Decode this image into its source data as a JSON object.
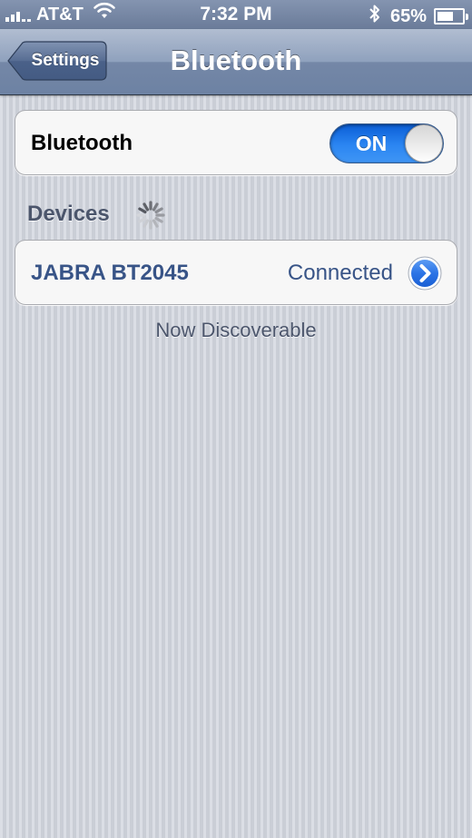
{
  "status_bar": {
    "carrier": "AT&T",
    "time": "7:32 PM",
    "battery_percent": "65%",
    "battery_level": 0.65,
    "icons": [
      "signal-icon",
      "wifi-icon",
      "bluetooth-icon",
      "battery-icon"
    ]
  },
  "nav": {
    "back_label": "Settings",
    "title": "Bluetooth"
  },
  "bluetooth_row": {
    "label": "Bluetooth",
    "toggle_label": "ON",
    "toggle_state": true
  },
  "devices_section": {
    "header": "Devices",
    "devices": [
      {
        "name": "JABRA BT2045",
        "status": "Connected"
      }
    ],
    "footer": "Now Discoverable"
  },
  "colors": {
    "accent": "#2b86f2",
    "device_text": "#385487",
    "section_text": "#4c566c"
  }
}
